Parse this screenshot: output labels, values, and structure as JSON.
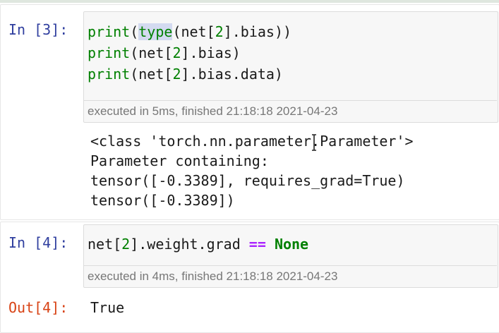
{
  "cells": [
    {
      "prompt": "In [3]:",
      "code_lines": [
        [
          {
            "t": "print",
            "c": "builtin"
          },
          {
            "t": "(",
            "c": ""
          },
          {
            "t": "type",
            "c": "builtin-hl"
          },
          {
            "t": "(net[",
            "c": ""
          },
          {
            "t": "2",
            "c": "num"
          },
          {
            "t": "].bias))",
            "c": ""
          }
        ],
        [
          {
            "t": "print",
            "c": "builtin"
          },
          {
            "t": "(net[",
            "c": ""
          },
          {
            "t": "2",
            "c": "num"
          },
          {
            "t": "].bias)",
            "c": ""
          }
        ],
        [
          {
            "t": "print",
            "c": "builtin"
          },
          {
            "t": "(net[",
            "c": ""
          },
          {
            "t": "2",
            "c": "num"
          },
          {
            "t": "].bias.data)",
            "c": ""
          }
        ]
      ],
      "exec_info": "executed in 5ms, finished 21:18:18 2021-04-23",
      "output_prompt": "",
      "output_lines": [
        "<class 'torch.nn.parameter.Parameter'>",
        "Parameter containing:",
        "tensor([-0.3389], requires_grad=True)",
        "tensor([-0.3389])"
      ]
    },
    {
      "prompt": "In [4]:",
      "code_lines": [
        [
          {
            "t": "net[",
            "c": ""
          },
          {
            "t": "2",
            "c": "num"
          },
          {
            "t": "].weight.grad ",
            "c": ""
          },
          {
            "t": "==",
            "c": "op"
          },
          {
            "t": " ",
            "c": ""
          },
          {
            "t": "None",
            "c": "kw"
          }
        ]
      ],
      "exec_info": "executed in 4ms, finished 21:18:18 2021-04-23",
      "output_prompt": "Out[4]:",
      "output_lines": [
        "True"
      ]
    }
  ],
  "colors": {
    "prompt_in": "#303f9f",
    "prompt_out": "#d84315",
    "builtin": "#008000",
    "operator": "#aa22ff",
    "input_bg": "#f7f7f7"
  },
  "icons": {
    "text_cursor": "i-beam-cursor-icon"
  }
}
